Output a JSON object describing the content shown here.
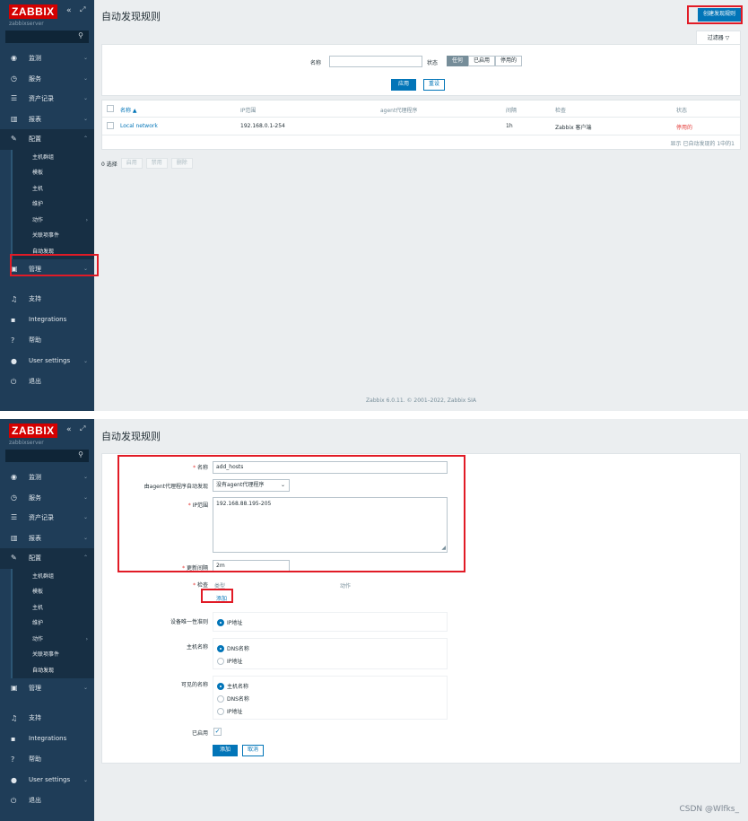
{
  "brand": {
    "logo": "ZABBIX",
    "collapse_icon": "«",
    "kiosk_icon": "⤢",
    "server_name": "zabbixserver"
  },
  "nav": {
    "items": [
      {
        "label": "监测",
        "icon": "eye-icon"
      },
      {
        "label": "服务",
        "icon": "clock-icon"
      },
      {
        "label": "资产记录",
        "icon": "list-icon"
      },
      {
        "label": "报表",
        "icon": "chart-icon"
      },
      {
        "label": "配置",
        "icon": "wrench-icon"
      }
    ],
    "config_sub": [
      "主机群组",
      "模板",
      "主机",
      "维护",
      "动作",
      "关联项事件",
      "自动发现"
    ],
    "after": [
      {
        "label": "管理",
        "icon": "admin-icon"
      }
    ],
    "bottom": [
      {
        "label": "支持",
        "icon": "headset-icon"
      },
      {
        "label": "Integrations",
        "icon": "integrations-icon"
      },
      {
        "label": "帮助",
        "icon": "help-icon"
      },
      {
        "label": "User settings",
        "icon": "user-icon"
      },
      {
        "label": "退出",
        "icon": "power-icon"
      }
    ]
  },
  "list_page": {
    "title": "自动发现规则",
    "create_button": "创建发现规则",
    "filter_tab": "过滤器",
    "filter": {
      "name_label": "名称",
      "status_label": "状态",
      "status_options": [
        "任何",
        "已启用",
        "停用的"
      ],
      "apply": "应用",
      "reset": "重设"
    },
    "table": {
      "headers": [
        "名称 ▲",
        "IP范围",
        "agent代理程序",
        "间隔",
        "检查",
        "状态"
      ],
      "rows": [
        {
          "name": "Local network",
          "ip_range": "192.168.0.1-254",
          "proxy": "",
          "interval": "1h",
          "checks": "Zabbix 客户端",
          "status": "停用的"
        }
      ],
      "paging": "显示 已自动发现的 1中的1"
    },
    "mass": {
      "selected": "0 选择",
      "buttons": [
        "启用",
        "禁用",
        "删除"
      ]
    },
    "footer": "Zabbix 6.0.11. © 2001–2022, Zabbix SIA"
  },
  "form_page": {
    "title": "自动发现规则",
    "fields": {
      "name_label": "名称",
      "name_value": "add_hosts",
      "proxy_label": "由agent代理程序自动发现",
      "proxy_value": "没有agent代理程序",
      "ip_label": "IP范围",
      "ip_value": "192.168.88.195-205",
      "interval_label": "更新间隔",
      "interval_value": "2m",
      "checks_label": "检查",
      "checks_col_type": "类型",
      "checks_col_action": "动作",
      "checks_add": "添加",
      "uniq_label": "设备唯一性准则",
      "uniq_options": [
        "IP地址"
      ],
      "hostname_label": "主机名称",
      "hostname_options": [
        "DNS名称",
        "IP地址"
      ],
      "visible_label": "可见的名称",
      "visible_options": [
        "主机名称",
        "DNS名称",
        "IP地址"
      ],
      "enabled_label": "已启用",
      "submit": "添加",
      "cancel": "取消"
    }
  },
  "watermark": "CSDN @Wlfks_"
}
